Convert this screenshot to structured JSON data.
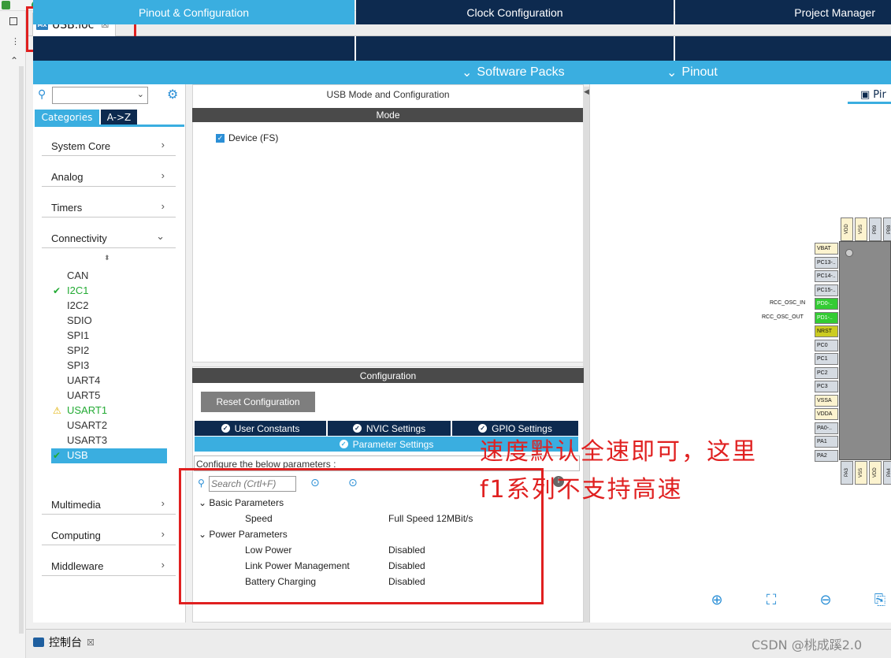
{
  "file_tab": {
    "label": "USB.ioc",
    "icon_text": "MX",
    "close": "☒"
  },
  "main_tabs": {
    "pinout": "Pinout & Configuration",
    "clock": "Clock Configuration",
    "project": "Project Manager"
  },
  "sub_tabs": {
    "software_packs": "Software Packs",
    "pinout": "Pinout"
  },
  "left": {
    "cat_tabs": [
      "Categories",
      "A->Z"
    ],
    "categories_top": [
      "System Core",
      "Analog",
      "Timers",
      "Connectivity"
    ],
    "connectivity_items": [
      "CAN",
      "I2C1",
      "I2C2",
      "SDIO",
      "SPI1",
      "SPI2",
      "SPI3",
      "UART4",
      "UART5",
      "USART1",
      "USART2",
      "USART3",
      "USB"
    ],
    "categories_bottom": [
      "Multimedia",
      "Computing",
      "Middleware"
    ]
  },
  "center": {
    "title": "USB Mode and Configuration",
    "mode_bar": "Mode",
    "device_label": "Device (FS)",
    "config_bar": "Configuration",
    "reset_button": "Reset Configuration",
    "cfg_tabs": [
      "User Constants",
      "NVIC Settings",
      "GPIO Settings"
    ],
    "param_tab": "Parameter Settings",
    "configure_text": "Configure the below parameters :",
    "search_placeholder": "Search (Crtl+F)",
    "groups": {
      "basic": "Basic Parameters",
      "power": "Power Parameters"
    },
    "params": [
      {
        "name": "Speed",
        "value": "Full Speed 12MBit/s"
      },
      {
        "name": "Low Power",
        "value": "Disabled"
      },
      {
        "name": "Link Power Management",
        "value": "Disabled"
      },
      {
        "name": "Battery Charging",
        "value": "Disabled"
      }
    ]
  },
  "right": {
    "pinout_tab": "Pir",
    "left_pins": [
      "VBAT",
      "PC13-..",
      "PC14-..",
      "PC15-..",
      "PD0-..",
      "PD1-..",
      "NRST",
      "PC0",
      "PC1",
      "PC2",
      "PC3",
      "VSSA",
      "VDDA",
      "PA0-..",
      "PA1",
      "PA2"
    ],
    "top_pins": [
      "VDD",
      "VSS",
      "PB9",
      "PB8"
    ],
    "bottom_pins": [
      "PA3",
      "VSS",
      "VDD",
      "PA4"
    ],
    "labels": {
      "osc_in": "RCC_OSC_IN",
      "osc_out": "RCC_OSC_OUT"
    }
  },
  "annotation": {
    "line1": "速度默认全速即可，这里",
    "line2": "f1系列不支持高速"
  },
  "console": {
    "label": "控制台",
    "close": "☒"
  },
  "watermark": "CSDN @桃成蹊2.0",
  "colors": {
    "accent": "#3aaee0",
    "navy": "#0d2a4f",
    "annotation": "#e02020"
  }
}
